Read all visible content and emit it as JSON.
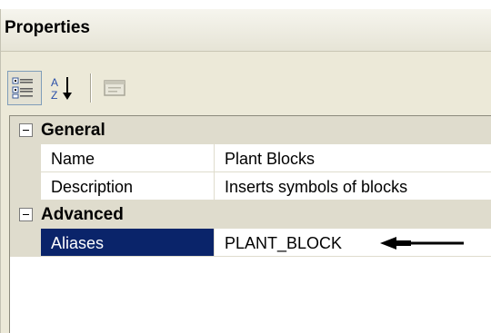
{
  "header_fragment": "",
  "panel": {
    "title": "Properties"
  },
  "toolbar": {
    "categorized_icon": "categorized-view-icon",
    "alphabetical_icon": "sort-alphabetical-icon",
    "property_pages_icon": "property-pages-icon"
  },
  "categories": [
    {
      "label": "General",
      "expanded": true,
      "properties": [
        {
          "name": "Name",
          "value": "Plant Blocks"
        },
        {
          "name": "Description",
          "value": "Inserts symbols of blocks"
        }
      ]
    },
    {
      "label": "Advanced",
      "expanded": true,
      "properties": [
        {
          "name": "Aliases",
          "value": "PLANT_BLOCK",
          "selected": true
        }
      ]
    }
  ],
  "annotation": {
    "icon": "pointing-arrow-icon"
  },
  "colors": {
    "panel_bg": "#ece9d8",
    "category_bg": "#dfdccd",
    "selection_bg": "#0a246a",
    "selection_text": "#ffffff"
  }
}
